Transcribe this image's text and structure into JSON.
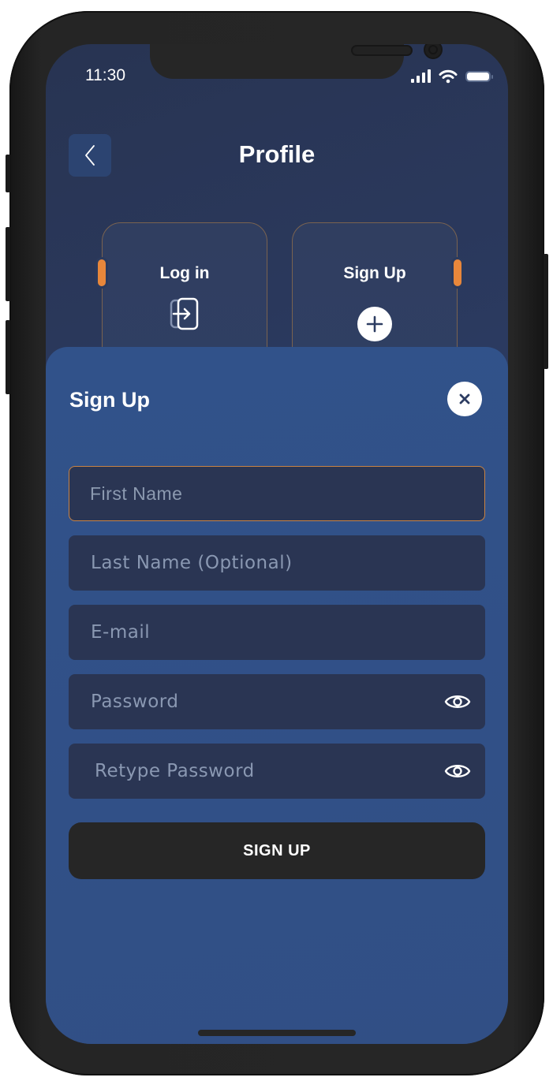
{
  "status_bar": {
    "time": "11:30",
    "icons": [
      "cellular-signal-icon",
      "wifi-icon",
      "battery-icon"
    ]
  },
  "header": {
    "title": "Profile",
    "back_icon": "chevron-left-icon"
  },
  "options": [
    {
      "label": "Log in",
      "icon": "login-icon"
    },
    {
      "label": "Sign Up",
      "icon": "plus-circle-icon"
    }
  ],
  "sheet": {
    "title": "Sign Up",
    "close_icon": "close-icon",
    "fields": [
      {
        "placeholder": "First Name",
        "value": "",
        "focused": true
      },
      {
        "placeholder": "Last Name (Optional)",
        "value": ""
      },
      {
        "placeholder": "E-mail",
        "value": ""
      },
      {
        "placeholder": "Password",
        "value": "",
        "icon": "eye-icon"
      },
      {
        "placeholder": "Retype Password",
        "value": "",
        "icon": "eye-icon"
      }
    ],
    "submit_label": "SIGN UP"
  },
  "colors": {
    "accent": "#e8873b",
    "focus_border": "#c98344",
    "sheet_bg": "#31528a",
    "field_bg": "#2a3553",
    "button_bg": "#262626"
  }
}
